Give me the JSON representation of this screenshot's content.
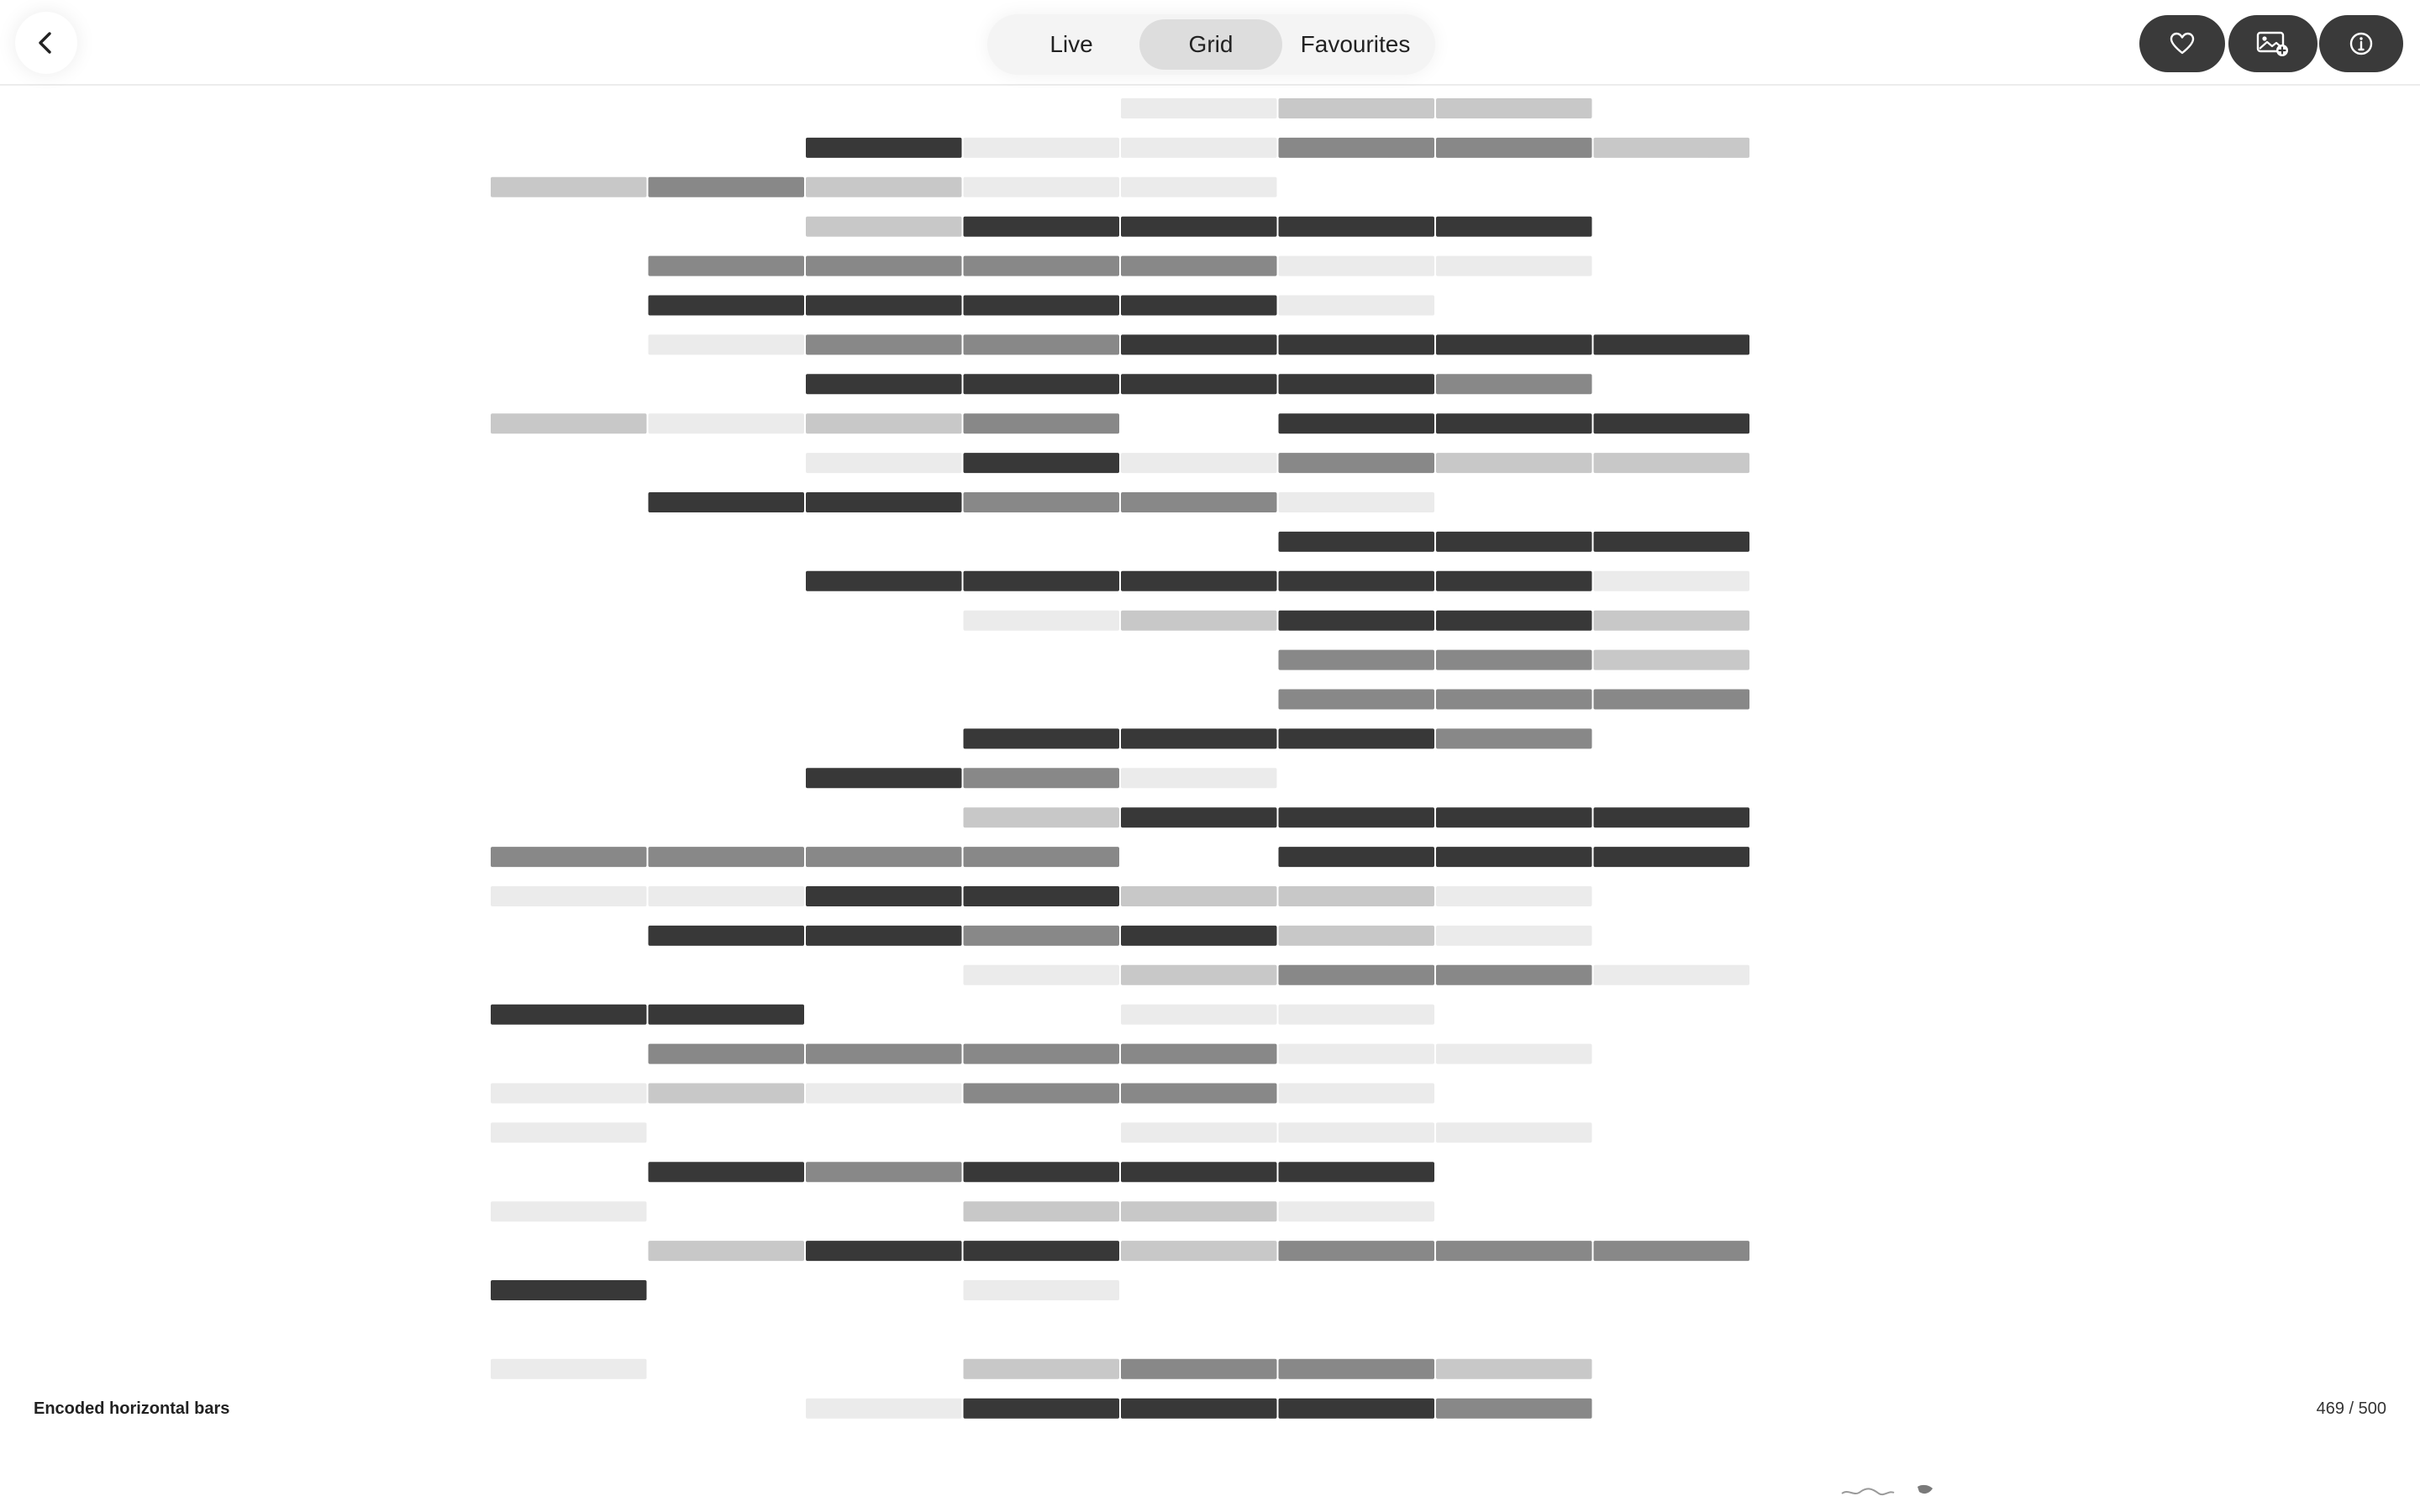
{
  "nav": {
    "tabs": [
      {
        "label": "Live"
      },
      {
        "label": "Grid",
        "selected": true
      },
      {
        "label": "Favourites"
      }
    ],
    "actions": [
      "heart-icon",
      "add-image-icon",
      "info-icon"
    ],
    "back_icon": "chevron-left-icon"
  },
  "artwork": {
    "title": "Encoded horizontal bars",
    "counter": "469 / 500",
    "colors": {
      "dark": "#383838",
      "mid": "#888888",
      "light": "#c8c8c8",
      "faint": "#ebebeb"
    },
    "columns": 9,
    "rows": [
      [
        "",
        "",
        "",
        "",
        "faint",
        "light",
        "light",
        "",
        ""
      ],
      [
        "",
        "",
        "dark",
        "faint",
        "faint",
        "mid",
        "mid",
        "light",
        ""
      ],
      [
        "light",
        "mid",
        "light",
        "faint",
        "faint",
        "",
        "",
        "",
        ""
      ],
      [
        "",
        "",
        "light",
        "dark",
        "dark",
        "dark",
        "dark",
        "",
        ""
      ],
      [
        "",
        "mid",
        "mid",
        "mid",
        "mid",
        "faint",
        "faint",
        "",
        ""
      ],
      [
        "",
        "dark",
        "dark",
        "dark",
        "dark",
        "faint",
        "",
        "",
        ""
      ],
      [
        "",
        "faint",
        "mid",
        "mid",
        "dark",
        "dark",
        "dark",
        "dark",
        ""
      ],
      [
        "",
        "",
        "dark",
        "dark",
        "dark",
        "dark",
        "mid",
        "",
        ""
      ],
      [
        "light",
        "faint",
        "light",
        "mid",
        "",
        "dark",
        "dark",
        "dark",
        ""
      ],
      [
        "",
        "",
        "faint",
        "dark",
        "faint",
        "mid",
        "light",
        "light",
        ""
      ],
      [
        "",
        "dark",
        "dark",
        "mid",
        "mid",
        "faint",
        "",
        "",
        ""
      ],
      [
        "",
        "",
        "",
        "",
        "",
        "dark",
        "dark",
        "dark",
        ""
      ],
      [
        "",
        "",
        "dark",
        "dark",
        "dark",
        "dark",
        "dark",
        "faint",
        ""
      ],
      [
        "",
        "",
        "",
        "faint",
        "light",
        "dark",
        "dark",
        "light",
        ""
      ],
      [
        "",
        "",
        "",
        "",
        "",
        "mid",
        "mid",
        "light",
        ""
      ],
      [
        "",
        "",
        "",
        "",
        "",
        "mid",
        "mid",
        "mid",
        ""
      ],
      [
        "",
        "",
        "",
        "dark",
        "dark",
        "dark",
        "mid",
        "",
        ""
      ],
      [
        "",
        "",
        "dark",
        "mid",
        "faint",
        "",
        "",
        "",
        ""
      ],
      [
        "",
        "",
        "",
        "light",
        "dark",
        "dark",
        "dark",
        "dark",
        ""
      ],
      [
        "mid",
        "mid",
        "mid",
        "mid",
        "",
        "dark",
        "dark",
        "dark",
        ""
      ],
      [
        "faint",
        "faint",
        "dark",
        "dark",
        "light",
        "light",
        "faint",
        "",
        ""
      ],
      [
        "",
        "dark",
        "dark",
        "mid",
        "dark",
        "light",
        "faint",
        "",
        ""
      ],
      [
        "",
        "",
        "",
        "faint",
        "light",
        "mid",
        "mid",
        "faint",
        ""
      ],
      [
        "dark",
        "dark",
        "",
        "",
        "faint",
        "faint",
        "",
        "",
        ""
      ],
      [
        "",
        "mid",
        "mid",
        "mid",
        "mid",
        "faint",
        "faint",
        "",
        ""
      ],
      [
        "faint",
        "light",
        "faint",
        "mid",
        "mid",
        "faint",
        "",
        "",
        ""
      ],
      [
        "faint",
        "",
        "",
        "",
        "faint",
        "faint",
        "faint",
        "",
        ""
      ],
      [
        "",
        "dark",
        "mid",
        "dark",
        "dark",
        "dark",
        "",
        "",
        ""
      ],
      [
        "faint",
        "",
        "",
        "light",
        "light",
        "faint",
        "",
        "",
        ""
      ],
      [
        "",
        "light",
        "dark",
        "dark",
        "light",
        "mid",
        "mid",
        "mid",
        ""
      ],
      [
        "dark",
        "",
        "",
        "faint",
        "",
        "",
        "",
        "",
        ""
      ],
      [
        "",
        "",
        "",
        "",
        "",
        "",
        "",
        "",
        ""
      ],
      [
        "faint",
        "",
        "",
        "light",
        "mid",
        "mid",
        "light",
        "",
        ""
      ],
      [
        "",
        "",
        "faint",
        "dark",
        "dark",
        "dark",
        "mid",
        "",
        ""
      ]
    ]
  }
}
